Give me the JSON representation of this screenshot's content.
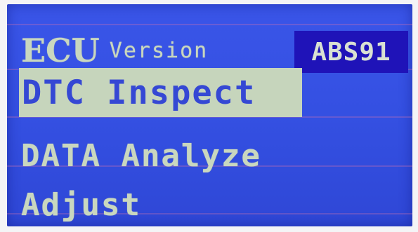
{
  "menu": {
    "ecu_version": {
      "big": "ECU",
      "small": "Version",
      "module": "ABS91"
    },
    "items": [
      {
        "label": "DTC Inspect",
        "selected": true
      },
      {
        "label": "DATA Analyze",
        "selected": false
      },
      {
        "label": "Adjust",
        "selected": false
      }
    ]
  },
  "colors": {
    "screen_bg": "#3450e2",
    "text": "#c9d7bf",
    "highlight_bg": "#c6d5bc",
    "badge_bg": "#1f13b8"
  }
}
